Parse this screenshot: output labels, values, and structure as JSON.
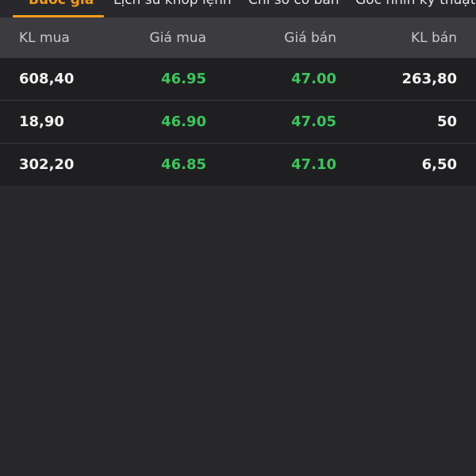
{
  "tabs": [
    {
      "label": "Bước giá",
      "active": true
    },
    {
      "label": "Lịch sử khớp lệnh",
      "active": false
    },
    {
      "label": "Chỉ số cơ bản",
      "active": false
    },
    {
      "label": "Góc nhìn kỹ thuật",
      "active": false
    }
  ],
  "table": {
    "headers": {
      "buy_volume": "KL mua",
      "buy_price": "Giá mua",
      "sell_price": "Giá bán",
      "sell_volume": "KL bán"
    },
    "rows": [
      {
        "buy_volume": "608,40",
        "buy_price": "46.95",
        "sell_price": "47.00",
        "sell_volume": "263,80"
      },
      {
        "buy_volume": "18,90",
        "buy_price": "46.90",
        "sell_price": "47.05",
        "sell_volume": "50"
      },
      {
        "buy_volume": "302,20",
        "buy_price": "46.85",
        "sell_price": "47.10",
        "sell_volume": "6,50"
      }
    ]
  },
  "colors": {
    "accent": "#f29b1d",
    "price_up": "#3ec45c",
    "background": "#29292d",
    "header_bg": "#3b3b40",
    "row_bg": "#1f1f22"
  }
}
